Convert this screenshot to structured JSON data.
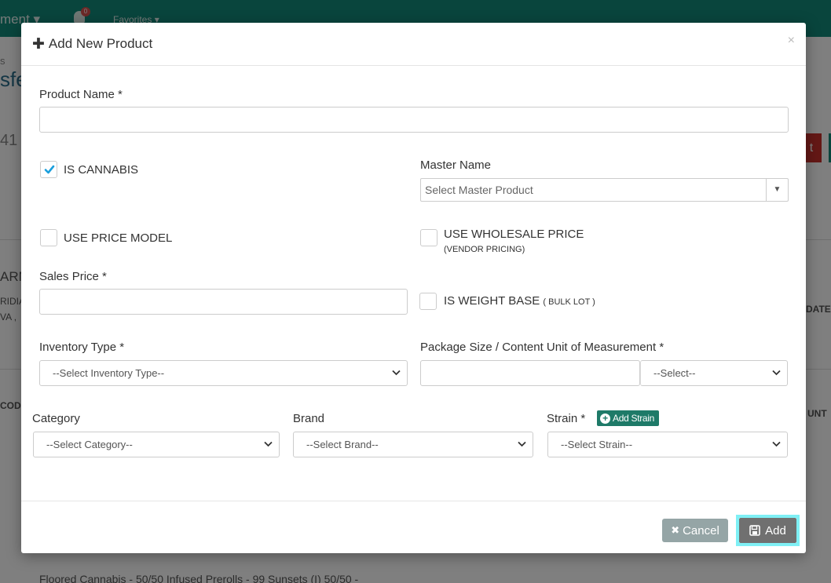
{
  "background": {
    "nav_text": "ment",
    "favorites": "Favorites",
    "bell_count": "0",
    "frag_s": "s",
    "frag_sfe": "sfe",
    "frag_41": "41",
    "frag_t": "t",
    "frag_arm": "ARM",
    "frag_ridia": "RIDIA",
    "frag_va": "VA ,",
    "frag_date": "DATE",
    "frag_code": "CODE",
    "frag_unt": "UNT",
    "bottom_row": "Floored Cannabis - 50/50 Infused Prerolls - 99 Sunsets (I) 50/50 -"
  },
  "modal": {
    "title": "Add New Product",
    "product_name_label": "Product Name *",
    "is_cannabis_label": "IS CANNABIS",
    "is_cannabis_checked": true,
    "master_name_label": "Master Name",
    "master_name_placeholder": "Select Master Product",
    "use_price_model_label": "USE PRICE MODEL",
    "use_wholesale_label": "USE WHOLESALE PRICE",
    "use_wholesale_sub": "(VENDOR PRICING)",
    "sales_price_label": "Sales Price *",
    "is_weight_base_label": "IS WEIGHT BASE",
    "is_weight_base_sub": "( BULK LOT )",
    "inventory_type_label": "Inventory Type *",
    "inventory_type_value": "--Select Inventory Type--",
    "package_size_label": "Package Size / Content Unit of Measurement *",
    "unit_value": "--Select--",
    "category_label": "Category",
    "category_value": "--Select Category--",
    "brand_label": "Brand",
    "brand_value": "--Select Brand--",
    "strain_label": "Strain *",
    "strain_value": "--Select Strain--",
    "add_strain_button": "Add Strain",
    "cancel_button": "Cancel",
    "add_button": "Add"
  },
  "colors": {
    "topbar": "#138a7a",
    "check_blue": "#1a9fdd",
    "add_strain_bg": "#1e7a68",
    "cancel_bg": "#95a5a6",
    "add_bg": "#707070",
    "add_focus_ring": "#7ff0f5"
  }
}
